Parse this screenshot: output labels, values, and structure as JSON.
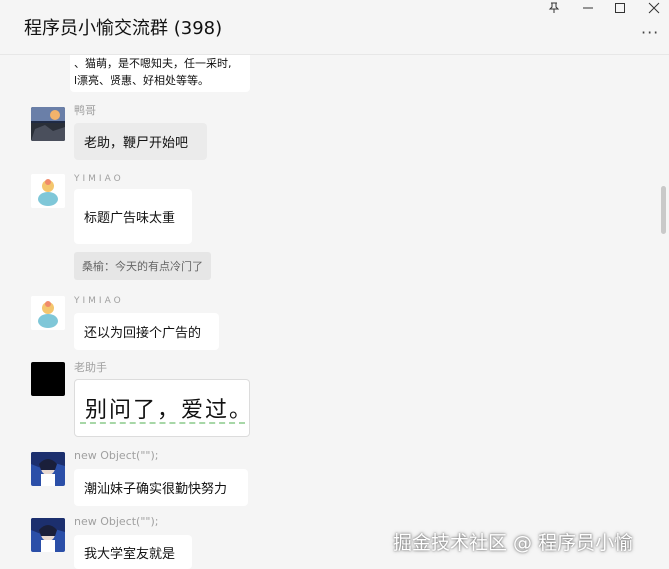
{
  "window": {
    "title": "程序员小愉交流群 (398)",
    "pin_icon": "pin-icon",
    "minimize_icon": "minimize-icon",
    "maximize_icon": "maximize-icon",
    "close_icon": "close-icon",
    "more_icon": "more-icon"
  },
  "messages": [
    {
      "type": "partial",
      "lines": [
        "、猫萌，是不嗯知夫，任一采时,",
        "l漂亮、贤惠、好相处等等。"
      ]
    },
    {
      "type": "msg",
      "sender": "鸭哥",
      "text": "老助，鞭尸开始吧"
    },
    {
      "type": "msg",
      "sender": "YIMIAO",
      "text": "标题广告味太重"
    },
    {
      "type": "system",
      "text": "桑榆：今天的有点冷门了"
    },
    {
      "type": "msg",
      "sender": "YIMIAO",
      "text": "还以为回接个广告的"
    },
    {
      "type": "msg",
      "sender": "老助手",
      "text": "别问了，爱过。"
    },
    {
      "type": "msg",
      "sender": "new Object(\"\");",
      "text": "潮汕妹子确实很勤快努力"
    },
    {
      "type": "msg",
      "sender": "new Object(\"\");",
      "text": "我大学室友就是"
    }
  ],
  "watermark": "掘金技术社区 @ 程序员小愉",
  "colors": {
    "background": "#f5f5f5",
    "bubble": "#ffffff",
    "system_bubble": "#e6e6e6",
    "sender_text": "#a0a0a0"
  }
}
